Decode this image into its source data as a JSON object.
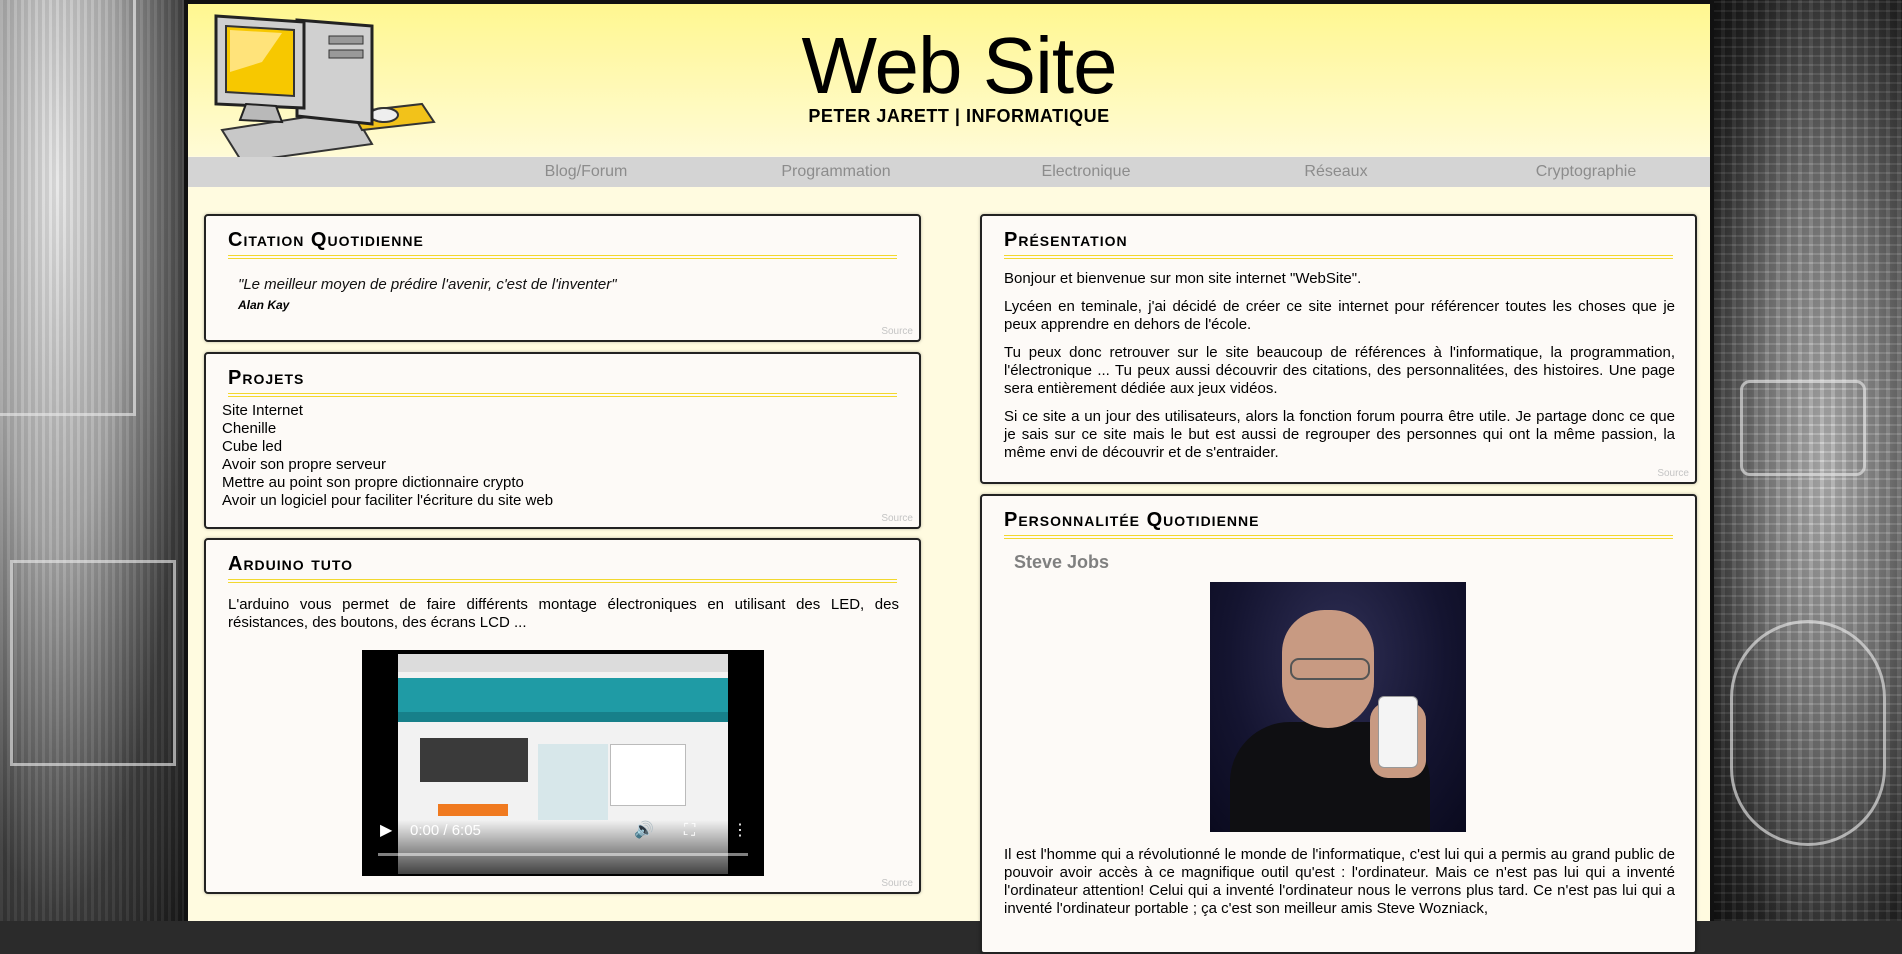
{
  "header": {
    "title": "Web Site",
    "subtitle": "PETER JARETT | INFORMATIQUE"
  },
  "nav": {
    "items": [
      "Blog/Forum",
      "Programmation",
      "Electronique",
      "Réseaux",
      "Cryptographie"
    ]
  },
  "citation": {
    "heading": "Citation Quotidienne",
    "quote": "\"Le meilleur moyen de prédire l'avenir, c'est de l'inventer\"",
    "author": "Alan Kay",
    "source": "Source"
  },
  "projets": {
    "heading": "Projets",
    "items": [
      "Site Internet",
      "Chenille",
      "Cube led",
      "Avoir son propre serveur",
      "Mettre au point son propre dictionnaire crypto",
      "Avoir un logiciel pour faciliter l'écriture du site web"
    ],
    "source": "Source"
  },
  "arduino": {
    "heading": "Arduino tuto",
    "text": "L'arduino vous permet de faire différents montage électroniques en utilisant des LED, des résistances, des boutons, des écrans LCD ...",
    "video_time": "0:00 / 6:05",
    "source": "Source"
  },
  "presentation": {
    "heading": "Présentation",
    "paragraphs": [
      "Bonjour et bienvenue sur mon site internet \"WebSite\".",
      "Lycéen en teminale, j'ai décidé de créer ce site internet pour référencer toutes les choses que je peux apprendre en dehors de l'école.",
      "Tu peux donc retrouver sur le site beaucoup de références à l'informatique, la programmation, l'électronique ... Tu peux aussi découvrir des citations, des personnalitées, des histoires. Une page sera entièrement dédiée aux jeux vidéos.",
      "Si ce site a un jour des utilisateurs, alors la fonction forum pourra être utile. Je partage donc ce que je sais sur ce site mais le but est aussi de regrouper des personnes qui ont la même passion, la même envi de découvrir et de s'entraider."
    ],
    "source": "Source"
  },
  "personnalite": {
    "heading": "Personnalitée Quotidienne",
    "name": "Steve Jobs",
    "text": "Il est l'homme qui a révolutionné le monde de l'informatique, c'est lui qui a permis au grand public de pouvoir avoir accès à ce magnifique outil qu'est : l'ordinateur. Mais ce n'est pas lui qui a inventé l'ordinateur attention! Celui qui a inventé l'ordinateur nous le verrons plus tard. Ce n'est pas lui qui a inventé l'ordinateur portable ; ça c'est son meilleur amis Steve Wozniack,"
  },
  "icons": {
    "logo": "computer-icon",
    "play": "play-icon",
    "volume": "volume-icon",
    "fullscreen": "fullscreen-icon",
    "more": "more-options-icon"
  },
  "colors": {
    "header_yellow": "#fff790",
    "page_bg": "#fffbe0",
    "heading_underline": "#f2d82e",
    "nav_bg": "#d4d4d4",
    "nav_text": "#8c8c8c"
  }
}
